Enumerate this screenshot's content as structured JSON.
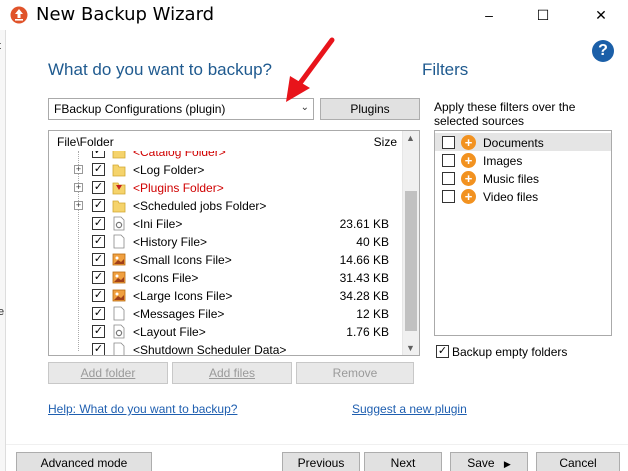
{
  "window": {
    "title": "New Backup Wizard",
    "minimize": "–",
    "maximize": "☐",
    "close": "✕"
  },
  "left_edge_chars": [
    "t",
    "i",
    "e"
  ],
  "help_button": "?",
  "main": {
    "heading": "What do you want to backup?",
    "source_select": {
      "value": "FBackup Configurations (plugin)"
    },
    "plugins_button": "Plugins",
    "tree": {
      "columns": [
        "File\\Folder",
        "Size"
      ],
      "rows": [
        {
          "label": "<Catalog Folder>",
          "size": "",
          "expander": false,
          "checked": true,
          "icon": "folder",
          "red": true
        },
        {
          "label": "<Log Folder>",
          "size": "",
          "expander": true,
          "checked": true,
          "icon": "folder",
          "red": false
        },
        {
          "label": "<Plugins Folder>",
          "size": "",
          "expander": true,
          "checked": true,
          "icon": "folder-plugin",
          "red": true
        },
        {
          "label": "<Scheduled jobs Folder>",
          "size": "",
          "expander": true,
          "checked": true,
          "icon": "folder",
          "red": false
        },
        {
          "label": "<Ini File>",
          "size": "23.61 KB",
          "expander": false,
          "checked": true,
          "icon": "gear-file",
          "red": false
        },
        {
          "label": "<History File>",
          "size": "40 KB",
          "expander": false,
          "checked": true,
          "icon": "file",
          "red": false
        },
        {
          "label": "<Small Icons File>",
          "size": "14.66 KB",
          "expander": false,
          "checked": true,
          "icon": "image-file",
          "red": false
        },
        {
          "label": "<Icons File>",
          "size": "31.43 KB",
          "expander": false,
          "checked": true,
          "icon": "image-file",
          "red": false
        },
        {
          "label": "<Large Icons File>",
          "size": "34.28 KB",
          "expander": false,
          "checked": true,
          "icon": "image-file",
          "red": false
        },
        {
          "label": "<Messages File>",
          "size": "12 KB",
          "expander": false,
          "checked": true,
          "icon": "file",
          "red": false
        },
        {
          "label": "<Layout File>",
          "size": "1.76 KB",
          "expander": false,
          "checked": true,
          "icon": "gear-file",
          "red": false
        },
        {
          "label": "<Shutdown Scheduler Data>",
          "size": "",
          "expander": false,
          "checked": true,
          "icon": "file",
          "red": false
        }
      ]
    },
    "add_folder": "Add folder",
    "add_files": "Add files",
    "remove": "Remove",
    "help_link": "Help: What do you want to backup?",
    "suggest_link": "Suggest a new plugin"
  },
  "filters": {
    "heading": "Filters",
    "description": "Apply these filters over the selected sources",
    "items": [
      {
        "label": "Documents",
        "checked": false,
        "selected": true
      },
      {
        "label": "Images",
        "checked": false,
        "selected": false
      },
      {
        "label": "Music files",
        "checked": false,
        "selected": false
      },
      {
        "label": "Video files",
        "checked": false,
        "selected": false
      }
    ],
    "backup_empty_folders": {
      "label": "Backup empty folders",
      "checked": true
    }
  },
  "footer": {
    "advanced_mode": "Advanced mode",
    "previous": "Previous",
    "next": "Next",
    "save": "Save",
    "save_arrow": "▶",
    "cancel": "Cancel"
  },
  "colors": {
    "heading": "#1f5a8f",
    "link": "#1f5fb0",
    "red_label": "#d00000",
    "plus_badge": "#f29220",
    "arrow": "#e8141b"
  }
}
